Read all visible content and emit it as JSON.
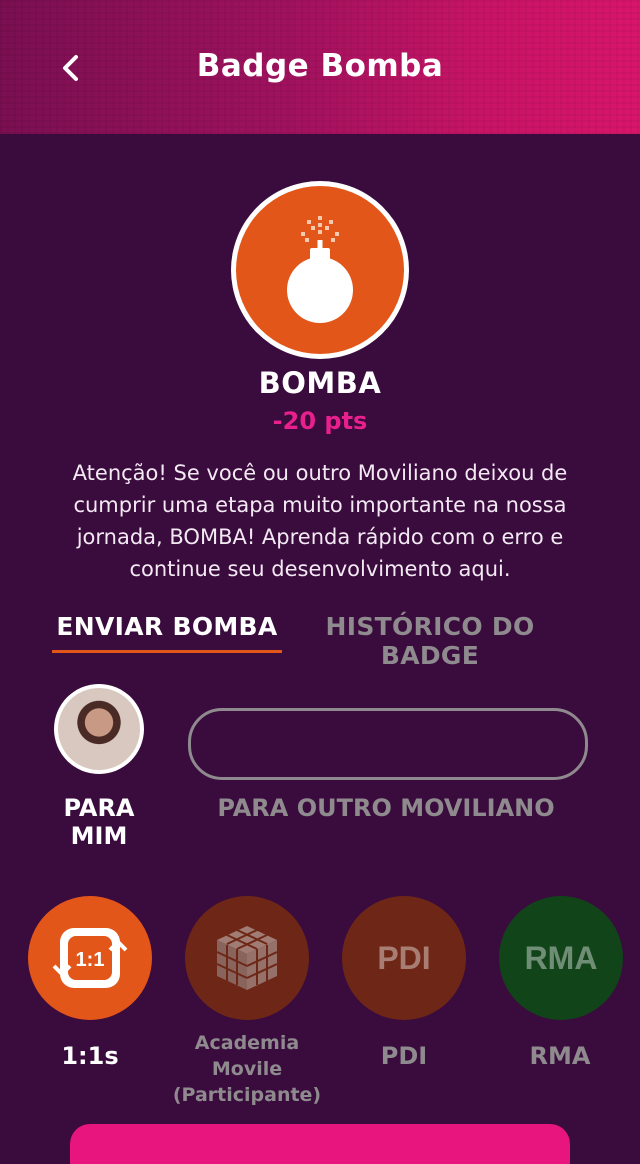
{
  "header": {
    "title": "Badge Bomba",
    "back_icon": "chevron-left-icon"
  },
  "badge": {
    "icon": "bomb-icon",
    "name": "BOMBA",
    "points": "-20 pts",
    "description": "Atenção! Se você ou outro Moviliano deixou de cumprir uma etapa muito importante na nossa jornada, BOMBA! Aprenda rápido com o erro e continue seu desenvolvimento aqui.",
    "color": "#e2561a"
  },
  "tabs": [
    {
      "label": "ENVIAR BOMBA",
      "active": true
    },
    {
      "label": "HISTÓRICO DO BADGE",
      "active": false
    }
  ],
  "recipients": {
    "self_label": "PARA MIM",
    "other_label": "PARA OUTRO MOVILIANO",
    "input_value": "",
    "input_placeholder": ""
  },
  "categories": [
    {
      "icon_text": "1:1",
      "icon": "one-on-one-icon",
      "label": "1:1s",
      "active": true,
      "color": "#e2561a"
    },
    {
      "icon_text": "",
      "icon": "rubiks-cube-icon",
      "label": "Academia Movile (Participante)",
      "active": false,
      "color": "#6e2716"
    },
    {
      "icon_text": "PDI",
      "icon": "pdi-icon",
      "label": "PDI",
      "active": false,
      "color": "#6e2716"
    },
    {
      "icon_text": "RMA",
      "icon": "rma-icon",
      "label": "RMA",
      "active": false,
      "color": "#114419"
    }
  ],
  "colors": {
    "background": "#3a0b3d",
    "accent_pink": "#ea1f8e",
    "accent_orange": "#e2561a",
    "muted": "#8e8a8e"
  }
}
